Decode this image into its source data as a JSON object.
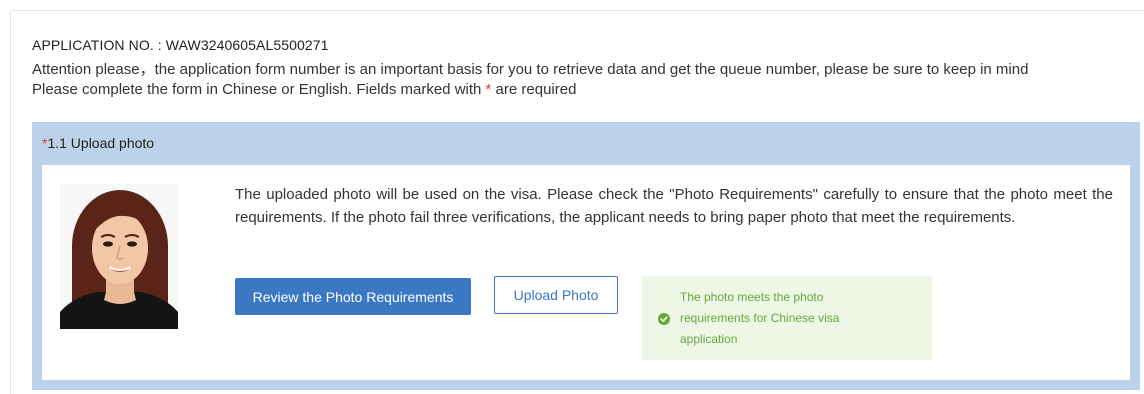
{
  "header": {
    "application_no": "APPLICATION NO. : WAW3240605AL5500271",
    "attention": "Attention please，the application form number is an important basis for you to retrieve data and get the queue number, please be sure to keep in mind",
    "instruction_before": "Please complete the form in Chinese or English. Fields marked with ",
    "required_mark": "*",
    "instruction_after": " are required"
  },
  "section": {
    "required_mark": "*",
    "title": "1.1 Upload photo",
    "description": "The uploaded photo will be used on the visa. Please check the \"Photo Requirements\" carefully to ensure that the photo meet the requirements. If the photo fail three verifications, the applicant needs to bring paper photo that meet the requirements.",
    "review_button": "Review the Photo Requirements",
    "upload_button": "Upload Photo",
    "success_message": "The photo meets the photo requirements for Chinese visa application",
    "success_icon": "check-circle-icon"
  },
  "colors": {
    "section_bg": "#bcd2ea",
    "primary": "#3a78c3",
    "success_text": "#63a83a",
    "success_bg": "#eef6e6",
    "required": "#e53935"
  }
}
